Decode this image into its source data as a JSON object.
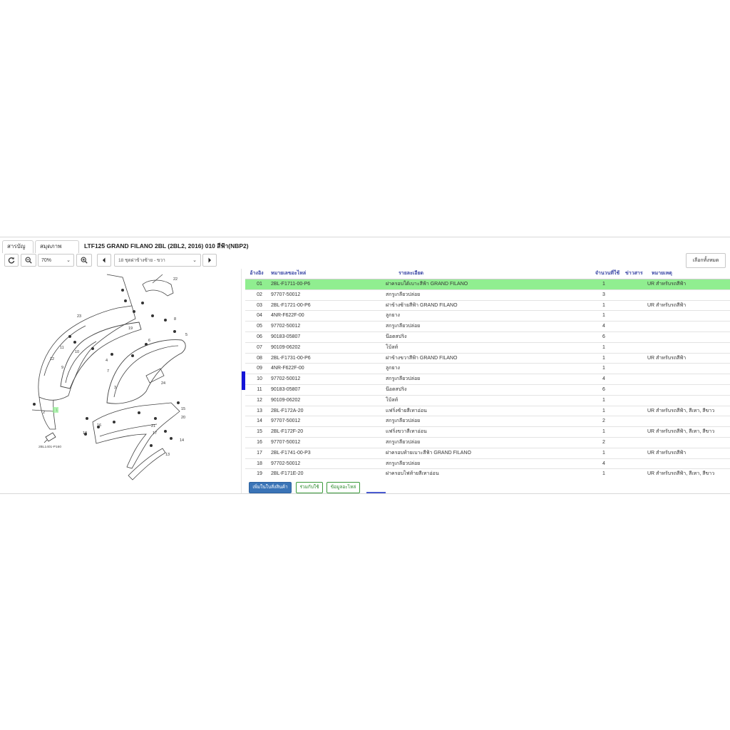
{
  "header": {
    "tabs": [
      {
        "label": "สารบัญชื่อ"
      },
      {
        "label": "สมุดภาพอะไหล่"
      }
    ],
    "title": "LTF125 GRAND FILANO 2BL (2BL2, 2016) 010 สีฟ้า(NBP2)"
  },
  "toolbar": {
    "zoom_value": "70%",
    "page_value": "18 ชุดฝาข้างซ้าย - ขวา",
    "select_all_label": "เลือกทั้งหมด"
  },
  "diagram": {
    "code_label": "2BL1401-P160",
    "callouts": [
      "1",
      "2",
      "3",
      "4",
      "5",
      "6",
      "7",
      "8",
      "9",
      "10",
      "11",
      "12",
      "13",
      "14",
      "15",
      "16",
      "17",
      "18",
      "19",
      "20",
      "21",
      "22",
      "23",
      "24"
    ]
  },
  "table": {
    "headers": {
      "ref": "อ้างอิง",
      "part_no": "หมายเลขอะไหล่",
      "desc": "รายละเอียด",
      "qty": "จำนวนที่ใช้",
      "news": "ข่าวสาร",
      "note": "หมายเหตุ"
    },
    "selected_index": 0,
    "rows": [
      {
        "ref": "01",
        "part_no": "2BL-F1711-00-P6",
        "desc": "ฝาครอบใต้เบาะสีฟ้า GRAND FILANO",
        "qty": "1",
        "note": "UR สำหรับรถสีฟ้า"
      },
      {
        "ref": "02",
        "part_no": "97707-50012",
        "desc": "สกรูเกลียวปล่อย",
        "qty": "3",
        "note": ""
      },
      {
        "ref": "03",
        "part_no": "2BL-F1721-00-P6",
        "desc": "ฝาข้างซ้ายสีฟ้า GRAND FILANO",
        "qty": "1",
        "note": "UR สำหรับรถสีฟ้า"
      },
      {
        "ref": "04",
        "part_no": "4NR-F622F-00",
        "desc": "ลูกยาง",
        "qty": "1",
        "note": ""
      },
      {
        "ref": "05",
        "part_no": "97702-50012",
        "desc": "สกรูเกลียวปล่อย",
        "qty": "4",
        "note": ""
      },
      {
        "ref": "06",
        "part_no": "90183-05807",
        "desc": "น๊อตสปริง",
        "qty": "6",
        "note": ""
      },
      {
        "ref": "07",
        "part_no": "90109-06202",
        "desc": "โบ้ลท์",
        "qty": "1",
        "note": ""
      },
      {
        "ref": "08",
        "part_no": "2BL-F1731-00-P6",
        "desc": "ฝาข้างขวาสีฟ้า GRAND FILANO",
        "qty": "1",
        "note": "UR สำหรับรถสีฟ้า"
      },
      {
        "ref": "09",
        "part_no": "4NR-F622F-00",
        "desc": "ลูกยาง",
        "qty": "1",
        "note": ""
      },
      {
        "ref": "10",
        "part_no": "97702-50012",
        "desc": "สกรูเกลียวปล่อย",
        "qty": "4",
        "note": ""
      },
      {
        "ref": "11",
        "part_no": "90183-05807",
        "desc": "น๊อตสปริง",
        "qty": "6",
        "note": ""
      },
      {
        "ref": "12",
        "part_no": "90109-06202",
        "desc": "โบ้ลท์",
        "qty": "1",
        "note": ""
      },
      {
        "ref": "13",
        "part_no": "2BL-F172A-20",
        "desc": "แฟริ่งซ้ายสีเทาอ่อน",
        "qty": "1",
        "note": "UR สำหรับรถสีฟ้า, สีเทา, สีขาว"
      },
      {
        "ref": "14",
        "part_no": "97707-50012",
        "desc": "สกรูเกลียวปล่อย",
        "qty": "2",
        "note": ""
      },
      {
        "ref": "15",
        "part_no": "2BL-F172F-20",
        "desc": "แฟริ่งขวาสีเทาอ่อน",
        "qty": "1",
        "note": "UR สำหรับรถสีฟ้า, สีเทา, สีขาว"
      },
      {
        "ref": "16",
        "part_no": "97707-50012",
        "desc": "สกรูเกลียวปล่อย",
        "qty": "2",
        "note": ""
      },
      {
        "ref": "17",
        "part_no": "2BL-F1741-00-P3",
        "desc": "ฝาครอบท้ายเบาะสีฟ้า GRAND FILANO",
        "qty": "1",
        "note": "UR สำหรับรถสีฟ้า"
      },
      {
        "ref": "18",
        "part_no": "97702-50012",
        "desc": "สกรูเกลียวปล่อย",
        "qty": "4",
        "note": ""
      },
      {
        "ref": "19",
        "part_no": "2BL-F171E-20",
        "desc": "ฝาครอบไฟท้ายสีเทาอ่อน",
        "qty": "1",
        "note": "UR สำหรับรถสีฟ้า, สีเทา, สีขาว"
      }
    ]
  },
  "actions": {
    "add_cart": "เพิ่มในใบสั่งสินค้า",
    "used_with": "ร่วมกับใช้",
    "part_info": "ข้อมูลอะไหล่"
  },
  "colors": {
    "selected_row": "#90ee90",
    "header_text": "#3a47a6",
    "primary_button": "#3a74b7",
    "outline_button": "#3a9a3a",
    "splitter": "#1515d8"
  }
}
